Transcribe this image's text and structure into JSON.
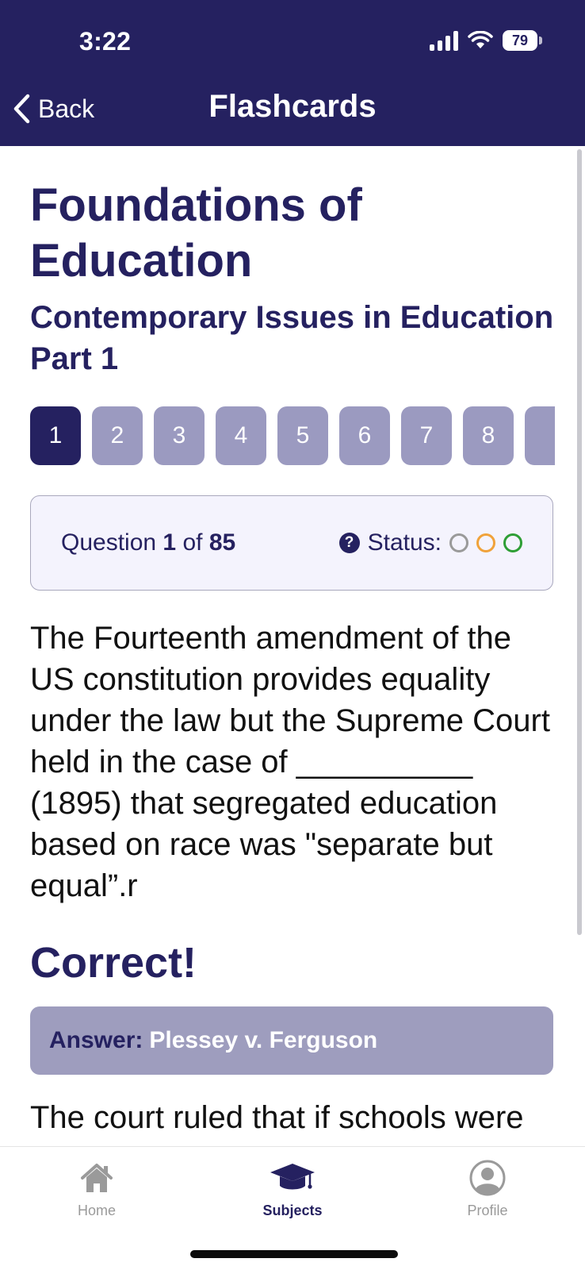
{
  "status_bar": {
    "time": "3:22",
    "battery": "79",
    "icons": [
      "signal-icon",
      "wifi-icon",
      "battery-icon"
    ]
  },
  "header": {
    "back_label": "Back",
    "title": "Flashcards"
  },
  "subject": {
    "title": "Foundations of Education",
    "topic": "Contemporary Issues in Education Part 1"
  },
  "question_tiles": [
    {
      "label": "1",
      "active": true
    },
    {
      "label": "2"
    },
    {
      "label": "3"
    },
    {
      "label": "4"
    },
    {
      "label": "5"
    },
    {
      "label": "6"
    },
    {
      "label": "7"
    },
    {
      "label": "8"
    },
    {
      "label": ""
    }
  ],
  "question_info": {
    "prefix": "Question",
    "current": "1",
    "of_word": "of",
    "total": "85",
    "status_label": "Status:",
    "status_colors": [
      "#9a9a9a",
      "#f0a23a",
      "#2e9e35"
    ]
  },
  "question": {
    "text": "The Fourteenth amendment of the US constitution provides equality under the law but the Supreme Court held in the case of __________ (1895) that segregated education based on race was \"separate but equal”.r"
  },
  "result": {
    "title": "Correct!",
    "answer_label": "Answer:",
    "answer_value": "Plessey v. Ferguson",
    "explanation": "The court ruled that if schools were equal, then segregation"
  },
  "tabbar": {
    "items": [
      {
        "label": "Home",
        "icon": "home-icon"
      },
      {
        "label": "Subjects",
        "icon": "graduation-cap-icon",
        "active": true
      },
      {
        "label": "Profile",
        "icon": "profile-icon"
      }
    ]
  },
  "colors": {
    "primary": "#252160",
    "tile_inactive": "#9b9ac0",
    "answer_bg": "#9e9dbe"
  }
}
